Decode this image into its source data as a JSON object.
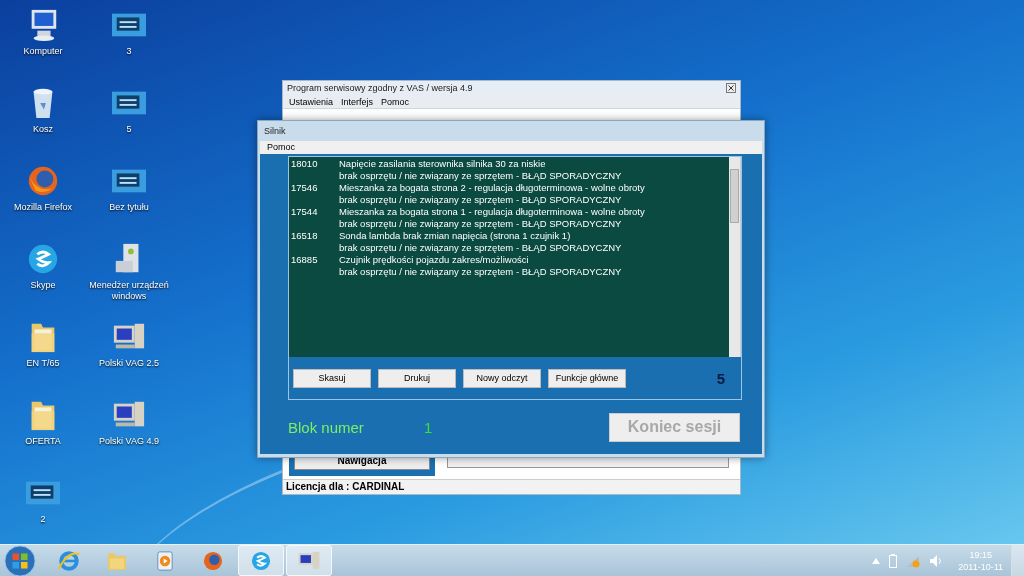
{
  "desktop": {
    "columns": [
      [
        {
          "label": "Komputer",
          "kind": "computer"
        },
        {
          "label": "Kosz",
          "kind": "recycle"
        },
        {
          "label": "Mozilla Firefox",
          "kind": "firefox"
        },
        {
          "label": "Skype",
          "kind": "skype"
        },
        {
          "label": "EN T/65",
          "kind": "folder"
        },
        {
          "label": "OFERTA",
          "kind": "folder"
        },
        {
          "label": "2",
          "kind": "screen"
        }
      ],
      [
        {
          "label": "3",
          "kind": "screen"
        },
        {
          "label": "5",
          "kind": "screen"
        },
        {
          "label": "Bez tytułu",
          "kind": "screen"
        },
        {
          "label": "Menedżer urządzeń windows",
          "kind": "server"
        },
        {
          "label": "Polski VAG 2.5",
          "kind": "pc"
        },
        {
          "label": "Polski VAG 4.9",
          "kind": "pc"
        }
      ]
    ]
  },
  "main_window": {
    "title": "Program serwisowy zgodny z VAS / wersja 4.9",
    "menu": [
      "Ustawienia",
      "Interfejs",
      "Pomoc"
    ],
    "nav_button": "Nawigacja",
    "status_bar": "Licencja dla : CARDINAL"
  },
  "dialog": {
    "title": "Silnik",
    "menu": [
      "Pomoc"
    ],
    "faults": [
      {
        "code": "18010",
        "description": "Napięcie zasilania sterownika silnika 30 za niskie",
        "detail": "brak osprzętu / nie związany ze sprzętem  -  BŁĄD SPORADYCZNY"
      },
      {
        "code": "17546",
        "description": "Mieszanka za bogata strona 2 - regulacja długoterminowa - wolne obroty",
        "detail": "brak osprzętu / nie związany ze sprzętem  -  BŁĄD SPORADYCZNY"
      },
      {
        "code": "17544",
        "description": "Mieszanka za bogata strona 1 - regulacja długoterminowa - wolne obroty",
        "detail": "brak osprzętu / nie związany ze sprzętem  -  BŁĄD SPORADYCZNY"
      },
      {
        "code": "16518",
        "description": "Sonda lambda brak zmian napięcia (strona 1 czujnik 1)",
        "detail": "brak osprzętu / nie związany ze sprzętem  -  BŁĄD SPORADYCZNY"
      },
      {
        "code": "16885",
        "description": "Czujnik prędkości pojazdu zakres/możliwości",
        "detail": "brak osprzętu / nie związany ze sprzętem  -  BŁĄD SPORADYCZNY"
      }
    ],
    "buttons": [
      "Skasuj",
      "Drukuj",
      "Nowy odczyt",
      "Funkcje główne"
    ],
    "fault_count": "5",
    "block_label": "Blok numer",
    "block_number": "1",
    "end_button": {
      "label": "Koniec sesji",
      "disabled": true
    }
  },
  "taskbar": {
    "items": [
      {
        "kind": "ie",
        "selected": false
      },
      {
        "kind": "folder",
        "selected": false
      },
      {
        "kind": "media",
        "selected": false
      },
      {
        "kind": "firefox",
        "selected": false
      },
      {
        "kind": "skype",
        "selected": true
      },
      {
        "kind": "pc",
        "selected": true
      }
    ],
    "time": "19:15",
    "date": "2011-10-11"
  }
}
